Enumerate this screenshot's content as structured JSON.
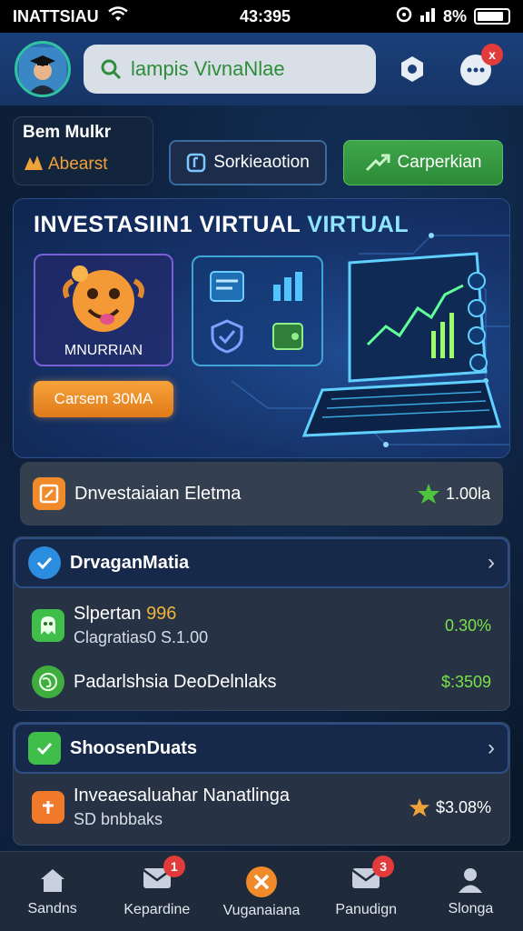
{
  "status_bar": {
    "carrier": "INATTSIAU",
    "time": "43:395",
    "battery_text": "8%"
  },
  "header": {
    "search_text": "lampis VivnaNlae",
    "chat_badge": "x"
  },
  "quick": {
    "card_title": "Bem Mulkr",
    "card_sub": "Abearst",
    "subscription_label": "Sorkieaotion",
    "compare_label": "Carperkian"
  },
  "banner": {
    "title_main": "INVESTASIIN1 VIRTUAL ",
    "title_accent": "VIRTUAL",
    "mascot_label": "MNURRIAN",
    "cta_label": "Carsem 30MA"
  },
  "summary": {
    "label": "Dnvestaiaian Eletma",
    "value": "1.00la"
  },
  "section1": {
    "title": "DrvaganMatia",
    "items": [
      {
        "title": "Slpertan ",
        "title_accent": "996",
        "sub": "Clagratias0 S.1.00",
        "value": "0.30%"
      },
      {
        "title": "Padarlshsia DeoDelnlaks",
        "value": "$:3509"
      }
    ]
  },
  "section2": {
    "title": "ShoosenDuats",
    "items": [
      {
        "title": "Inveaesaluahar Nanatlinga",
        "sub": "SD bnbbaks",
        "value": "$3.08%"
      }
    ]
  },
  "nav": {
    "items": [
      {
        "label": "Sandns"
      },
      {
        "label": "Kepardine",
        "badge": "1"
      },
      {
        "label": "Vuganaiana"
      },
      {
        "label": "Panudign",
        "badge": "3"
      },
      {
        "label": "Slonga"
      }
    ]
  },
  "colors": {
    "accent_green": "#3fa64a",
    "accent_orange": "#f0a23a",
    "header_blue": "#1a3f7a",
    "positive": "#7be04a"
  }
}
